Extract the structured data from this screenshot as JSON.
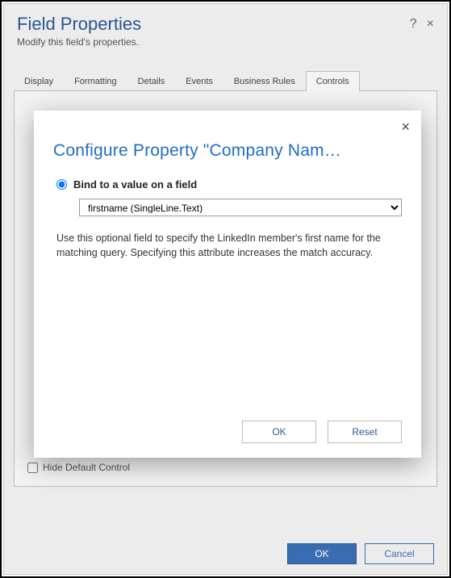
{
  "header": {
    "title": "Field Properties",
    "subtitle": "Modify this field's properties.",
    "help_icon": "?",
    "close_icon": "×"
  },
  "tabs": {
    "items": [
      {
        "label": "Display"
      },
      {
        "label": "Formatting"
      },
      {
        "label": "Details"
      },
      {
        "label": "Events"
      },
      {
        "label": "Business Rules"
      },
      {
        "label": "Controls"
      }
    ],
    "active_index": 5
  },
  "panel": {
    "hide_default_label": "Hide Default Control",
    "hide_default_checked": false
  },
  "footer": {
    "ok_label": "OK",
    "cancel_label": "Cancel"
  },
  "modal": {
    "title": "Configure Property \"Company Nam…",
    "close_icon": "×",
    "radio_label": "Bind to a value on a field",
    "radio_checked": true,
    "select_value": "firstname (SingleLine.Text)",
    "description": "Use this optional field to specify the LinkedIn member's first name for the matching query. Specifying this attribute increases the match accuracy.",
    "ok_label": "OK",
    "reset_label": "Reset"
  }
}
